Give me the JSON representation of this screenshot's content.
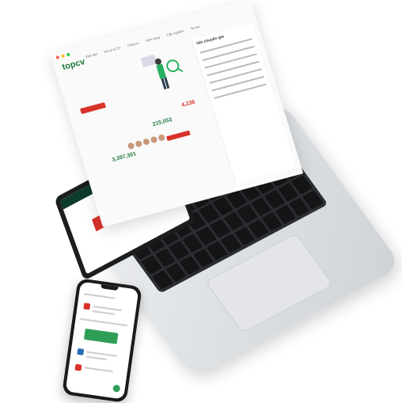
{
  "website": {
    "logo": "topcv",
    "nav_items": [
      "Việc làm",
      "Hồ sơ & CV",
      "Công cụ",
      "Cẩm nang",
      "Trắc nghiệm",
      "Tin tức"
    ],
    "stat_numbers": [
      "3,397,301",
      "215,053",
      "4,236"
    ],
    "side_title": "Hỏi chuyên gia"
  },
  "colors": {
    "brand_green": "#1f7a3b",
    "accent_red": "#d8322a"
  },
  "icons": [
    "laptop-icon",
    "smartphone-icon"
  ]
}
